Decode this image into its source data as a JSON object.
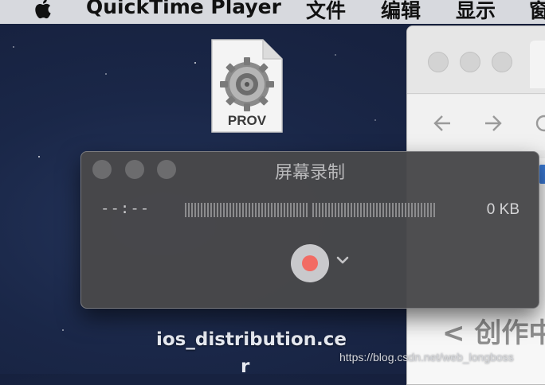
{
  "menubar": {
    "app_name": "QuickTime Player",
    "items": [
      "文件",
      "编辑",
      "显示",
      "窗"
    ]
  },
  "desktop": {
    "file_badge": "PROV",
    "file_label_line1": "ios_distribution.ce",
    "file_label_line2": "r"
  },
  "recorder": {
    "title": "屏幕录制",
    "elapsed": "--:--",
    "file_size": "0 KB",
    "record_button_icon": "record-icon",
    "options_icon": "chevron-down-icon",
    "record_color": "#f26b63"
  },
  "browser": {
    "back_icon": "back-arrow-icon",
    "forward_icon": "forward-arrow-icon",
    "content_text": "< 创作中"
  },
  "watermark": "https://blog.csdn.net/web_longboss"
}
